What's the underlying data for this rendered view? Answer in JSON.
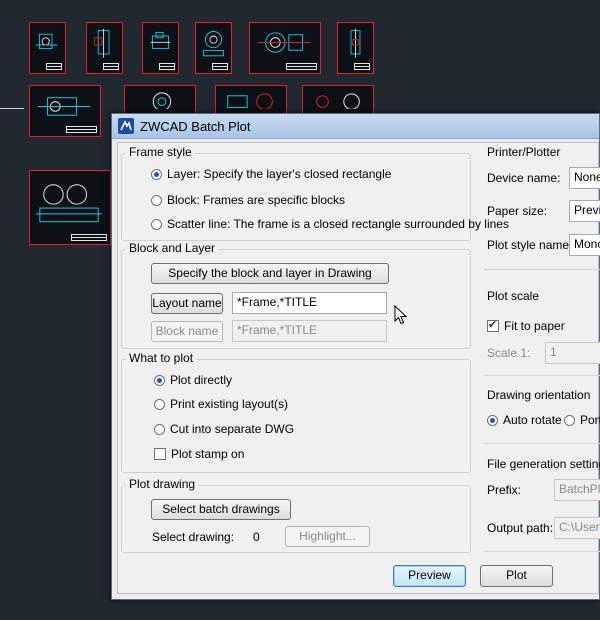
{
  "window": {
    "title": "ZWCAD Batch Plot",
    "app_icon": "zwcad-logo-icon"
  },
  "colors": {
    "cad_background": "#212830",
    "frame_border": "#e0202a",
    "title_gradient": "#c8daf0",
    "default_button": "#c4e5f6"
  },
  "frame_style": {
    "title": "Frame style",
    "options": [
      {
        "label": "Layer: Specify the layer's closed rectangle",
        "selected": true
      },
      {
        "label": "Block: Frames are specific blocks",
        "selected": false
      },
      {
        "label": "Scatter line: The frame is a closed rectangle surrounded by lines",
        "selected": false
      }
    ]
  },
  "block_layer": {
    "title": "Block and Layer",
    "specify_button": "Specify the block and layer in Drawing",
    "layout_name_button": "Layout name",
    "layout_name_value": "*Frame,*TITLE",
    "block_name_button": "Block name",
    "block_name_value": "*Frame,*TITLE"
  },
  "what_to_plot": {
    "title": "What to plot",
    "options": [
      {
        "label": "Plot directly",
        "selected": true
      },
      {
        "label": "Print existing layout(s)",
        "selected": false
      },
      {
        "label": "Cut into separate DWG",
        "selected": false
      }
    ],
    "plot_stamp_label": "Plot stamp on",
    "plot_stamp_checked": false
  },
  "plot_drawing": {
    "title": "Plot drawing",
    "select_button": "Select batch drawings",
    "select_label": "Select drawing:",
    "count": "0",
    "highlight_button": "Highlight..."
  },
  "printer": {
    "title": "Printer/Plotter",
    "device_label": "Device name:",
    "device_value": "None",
    "paper_label": "Paper size:",
    "paper_value": "Previo",
    "style_label": "Plot style name:",
    "style_value": "Mono"
  },
  "plot_scale": {
    "title": "Plot scale",
    "fit_label": "Fit to paper",
    "fit_checked": true,
    "scale_label": "Scale 1:",
    "scale_value": "1"
  },
  "orientation": {
    "title": "Drawing orientation",
    "options": [
      {
        "label": "Auto rotate",
        "selected": true
      },
      {
        "label": "Port",
        "selected": false
      }
    ]
  },
  "file_gen": {
    "title": "File generation settings",
    "prefix_label": "Prefix:",
    "prefix_value": "BatchPlo",
    "output_label": "Output path:",
    "output_value": "C:\\Users\\"
  },
  "buttons": {
    "preview": "Preview",
    "plot": "Plot"
  }
}
